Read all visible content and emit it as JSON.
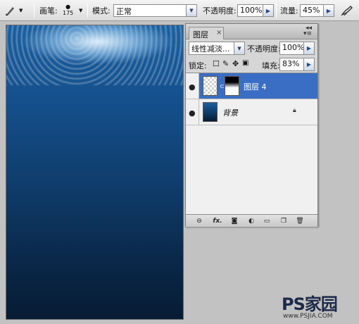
{
  "options_bar": {
    "tool_icon": "brush-icon",
    "brush_label": "画笔:",
    "brush_size": "175",
    "mode_label": "模式:",
    "mode_value": "正常",
    "opacity_label": "不透明度:",
    "opacity_value": "100%",
    "flow_label": "流量:",
    "flow_value": "45%",
    "airbrush_icon": "airbrush-icon"
  },
  "layers_panel": {
    "tab_label": "图层",
    "close_glyph": "×",
    "blend_mode": "线性减淡...",
    "opacity_label": "不透明度:",
    "opacity_value": "100%",
    "lock_label": "锁定:",
    "fill_label": "填充:",
    "fill_value": "83%",
    "layers": [
      {
        "name": "图层 4",
        "selected": true,
        "visible": true,
        "has_mask": true
      },
      {
        "name": "背景",
        "selected": false,
        "visible": true,
        "locked": true
      }
    ],
    "footer_icons": [
      "link-layers-icon",
      "fx-icon",
      "add-mask-icon",
      "adjustment-layer-icon",
      "new-group-icon",
      "new-layer-icon",
      "trash-icon"
    ],
    "footer_fx_label": "fx."
  },
  "watermark": {
    "text": "PS家园",
    "url": "www.PSJIA.COM"
  },
  "colors": {
    "selection": "#3a6ec4",
    "canvas_top": "#1a5fa0",
    "canvas_bottom": "#071b33"
  }
}
